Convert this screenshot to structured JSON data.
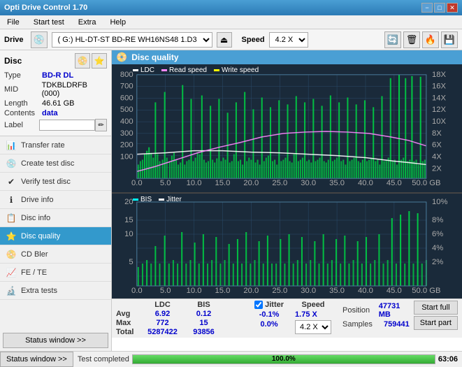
{
  "titleBar": {
    "title": "Opti Drive Control 1.70",
    "minimize": "−",
    "maximize": "□",
    "close": "✕"
  },
  "menuBar": {
    "items": [
      "File",
      "Start test",
      "Extra",
      "Help"
    ]
  },
  "driveBar": {
    "driveLabel": "Drive",
    "driveValue": "(G:) HL-DT-ST BD-RE  WH16NS48 1.D3",
    "speedLabel": "Speed",
    "speedValue": "4.2 X"
  },
  "sidebar": {
    "discTitle": "Disc",
    "discInfo": {
      "typeLabel": "Type",
      "typeValue": "BD-R DL",
      "midLabel": "MID",
      "midValue": "TDKBLDRFB (000)",
      "lengthLabel": "Length",
      "lengthValue": "46.61 GB",
      "contentsLabel": "Contents",
      "contentsValue": "data",
      "labelLabel": "Label"
    },
    "navItems": [
      {
        "id": "transfer-rate",
        "label": "Transfer rate",
        "icon": "📊"
      },
      {
        "id": "create-test-disc",
        "label": "Create test disc",
        "icon": "💿"
      },
      {
        "id": "verify-test-disc",
        "label": "Verify test disc",
        "icon": "✔"
      },
      {
        "id": "drive-info",
        "label": "Drive info",
        "icon": "ℹ"
      },
      {
        "id": "disc-info",
        "label": "Disc info",
        "icon": "📋"
      },
      {
        "id": "disc-quality",
        "label": "Disc quality",
        "icon": "⭐",
        "active": true
      },
      {
        "id": "cd-bler",
        "label": "CD Bler",
        "icon": "📀"
      },
      {
        "id": "fe-te",
        "label": "FE / TE",
        "icon": "📈"
      },
      {
        "id": "extra-tests",
        "label": "Extra tests",
        "icon": "🔬"
      }
    ],
    "statusBtn": "Status window >>"
  },
  "chartHeader": {
    "title": "Disc quality",
    "icon": "📀"
  },
  "chart1": {
    "legend": [
      {
        "label": "LDC",
        "color": "#ffffff"
      },
      {
        "label": "Read speed",
        "color": "#ff00ff"
      },
      {
        "label": "Write speed",
        "color": "#ffff00"
      }
    ],
    "yAxisMax": 800,
    "yAxisRight": [
      "18X",
      "16X",
      "14X",
      "12X",
      "10X",
      "8X",
      "6X",
      "4X",
      "2X"
    ],
    "xAxisLabels": [
      "0.0",
      "5.0",
      "10.0",
      "15.0",
      "20.0",
      "25.0",
      "30.0",
      "35.0",
      "40.0",
      "45.0",
      "50.0 GB"
    ]
  },
  "chart2": {
    "legend": [
      {
        "label": "BIS",
        "color": "#00ffff"
      },
      {
        "label": "Jitter",
        "color": "#ffffff"
      }
    ],
    "yAxisMax": 20,
    "yAxisRight": [
      "10%",
      "8%",
      "6%",
      "4%",
      "2%"
    ],
    "xAxisLabels": [
      "0.0",
      "5.0",
      "10.0",
      "15.0",
      "20.0",
      "25.0",
      "30.0",
      "35.0",
      "40.0",
      "45.0",
      "50.0 GB"
    ]
  },
  "stats": {
    "columns": [
      "",
      "LDC",
      "BIS",
      "",
      "Jitter",
      "Speed",
      ""
    ],
    "rows": [
      {
        "label": "Avg",
        "ldc": "6.92",
        "bis": "0.12",
        "jitter": "-0.1%",
        "speed": "1.75 X"
      },
      {
        "label": "Max",
        "ldc": "772",
        "bis": "15",
        "jitter": "0.0%",
        "position": "47731 MB"
      },
      {
        "label": "Total",
        "ldc": "5287422",
        "bis": "93856",
        "jitter": "",
        "samples": "759441"
      }
    ],
    "jitterLabel": "Jitter",
    "speedDropdown": "4.2 X",
    "positionLabel": "Position",
    "samplesLabel": "Samples",
    "startFullBtn": "Start full",
    "startPartBtn": "Start part"
  },
  "statusBar": {
    "statusWindowBtn": "Status window >>",
    "statusText": "Test completed",
    "progressPct": "100.0%",
    "progressWidth": 100,
    "timeValue": "63:06"
  }
}
